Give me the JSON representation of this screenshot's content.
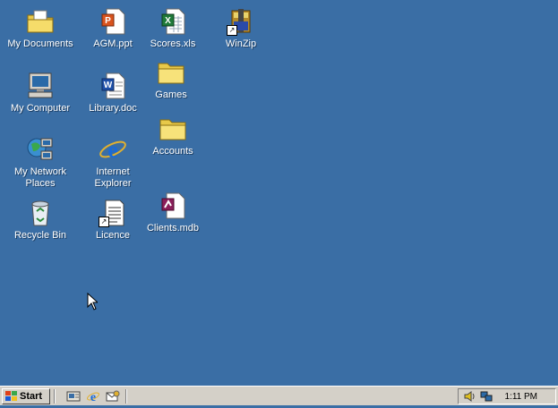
{
  "desktop": {
    "icons": [
      {
        "label": "My Documents",
        "icon": "folder-documents-icon"
      },
      {
        "label": "AGM.ppt",
        "icon": "powerpoint-file-icon"
      },
      {
        "label": "Scores.xls",
        "icon": "excel-file-icon"
      },
      {
        "label": "WinZip",
        "icon": "winzip-icon"
      },
      {
        "label": "Games",
        "icon": "folder-icon"
      },
      {
        "label": "My Computer",
        "icon": "computer-icon"
      },
      {
        "label": "Library.doc",
        "icon": "word-file-icon"
      },
      {
        "label": "Accounts",
        "icon": "folder-icon"
      },
      {
        "label": "My Network Places",
        "icon": "network-places-icon"
      },
      {
        "label": "Internet Explorer",
        "icon": "internet-explorer-icon"
      },
      {
        "label": "Recycle Bin",
        "icon": "recycle-bin-icon"
      },
      {
        "label": "Licence",
        "icon": "text-document-icon"
      },
      {
        "label": "Clients.mdb",
        "icon": "access-file-icon"
      }
    ]
  },
  "taskbar": {
    "start_label": "Start",
    "quick_launch": [
      "show-desktop-icon",
      "internet-explorer-icon",
      "outlook-express-icon"
    ],
    "tray_icons": [
      "volume-icon",
      "network-icon"
    ],
    "clock": "1:11 PM"
  },
  "colors": {
    "desktop": "#3a6ea5",
    "taskbar": "#d4d0c8"
  }
}
